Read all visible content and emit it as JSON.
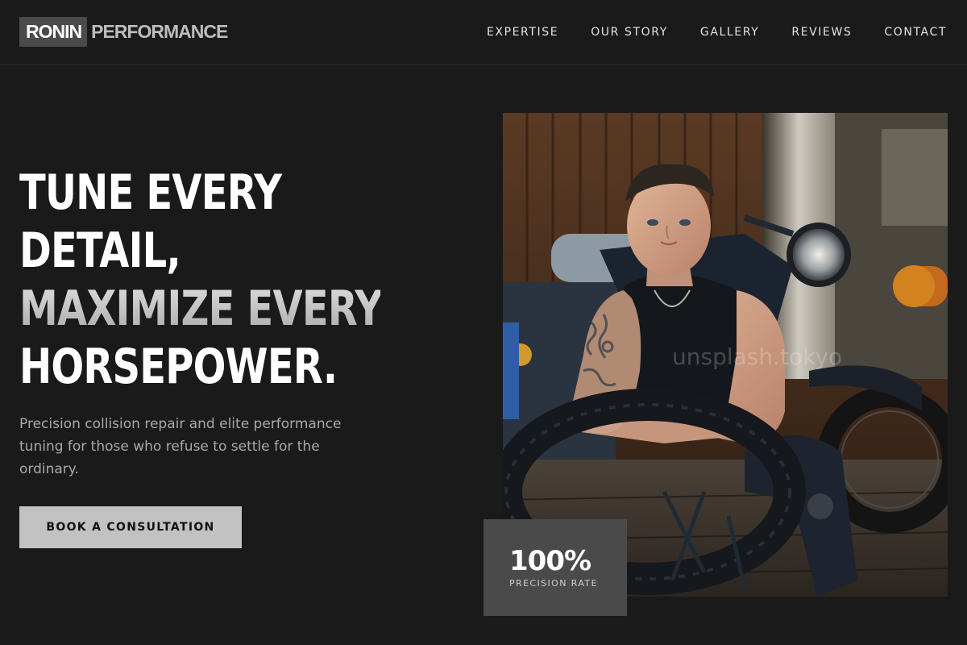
{
  "brand": {
    "primary": "RONIN",
    "secondary": "PERFORMANCE"
  },
  "nav": {
    "items": [
      {
        "label": "EXPERTISE"
      },
      {
        "label": "OUR STORY"
      },
      {
        "label": "GALLERY"
      },
      {
        "label": "REVIEWS"
      },
      {
        "label": "CONTACT"
      }
    ]
  },
  "hero": {
    "title_lines": [
      "TUNE EVERY",
      "DETAIL,",
      "MAXIMIZE EVERY",
      "HORSEPOWER."
    ],
    "description": "Precision collision repair and elite performance tuning for those who refuse to settle for the ordinary.",
    "cta_label": "BOOK A CONSULTATION",
    "image_watermark": "unsplash.tokyo"
  },
  "stat": {
    "value": "100%",
    "label": "PRECISION RATE"
  },
  "colors": {
    "background": "#1a1a1a",
    "logo_box": "#4a4a4a",
    "cta_bg": "#c2c2c2",
    "stat_card_bg": "#4a4a4a",
    "accent_grey": "#b0b0b0"
  }
}
